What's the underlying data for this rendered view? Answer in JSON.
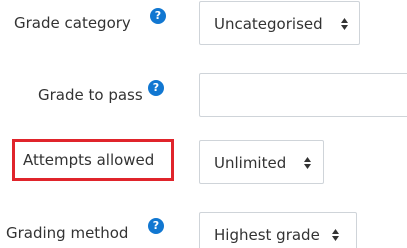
{
  "form": {
    "grade_category": {
      "label": "Grade category",
      "help_icon": "question-circle-icon",
      "selected": "Uncategorised"
    },
    "grade_to_pass": {
      "label": "Grade to pass",
      "help_icon": "question-circle-icon",
      "value": ""
    },
    "attempts_allowed": {
      "label": "Attempts allowed",
      "selected": "Unlimited",
      "highlight_color": "#e0242b"
    },
    "grading_method": {
      "label": "Grading method",
      "help_icon": "question-circle-icon",
      "selected": "Highest grade"
    }
  },
  "colors": {
    "help_icon": "#1177d1",
    "border": "#cfd4d9",
    "text": "#333333"
  }
}
